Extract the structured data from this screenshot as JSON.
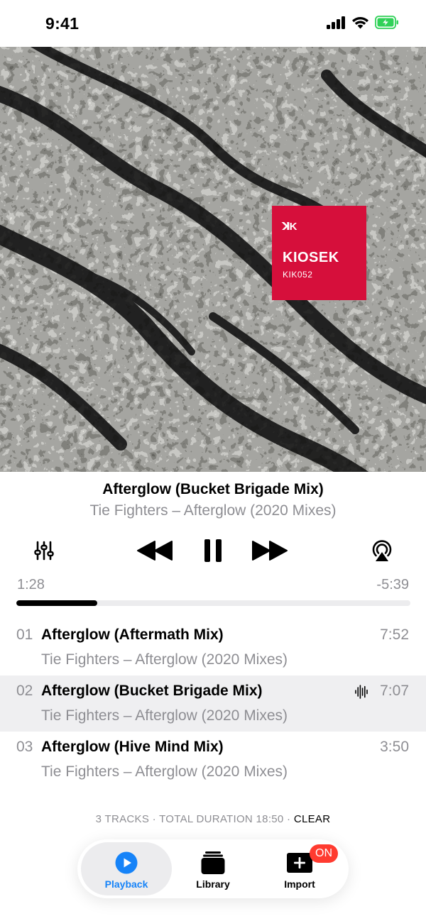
{
  "status_bar": {
    "time": "9:41"
  },
  "artwork": {
    "label_mark": "ꓘK",
    "label_name": "KIOSEK",
    "catalog": "KIK052"
  },
  "now_playing": {
    "title": "Afterglow (Bucket Brigade Mix)",
    "subtitle": "Tie Fighters – Afterglow (2020 Mixes)",
    "elapsed": "1:28",
    "remaining": "-5:39",
    "progress_fraction": 0.206
  },
  "queue": {
    "tracks": [
      {
        "number": "01",
        "title": "Afterglow (Aftermath Mix)",
        "subtitle": "Tie Fighters – Afterglow (2020 Mixes)",
        "duration": "7:52"
      },
      {
        "number": "02",
        "title": "Afterglow (Bucket Brigade Mix)",
        "subtitle": "Tie Fighters – Afterglow (2020 Mixes)",
        "duration": "7:07",
        "playing": true
      },
      {
        "number": "03",
        "title": "Afterglow (Hive Mind Mix)",
        "subtitle": "Tie Fighters – Afterglow (2020 Mixes)",
        "duration": "3:50"
      }
    ],
    "summary": "3 TRACKS · TOTAL DURATION 18:50 · ",
    "clear_label": "CLEAR"
  },
  "tab_bar": {
    "playback_label": "Playback",
    "library_label": "Library",
    "import_label": "Import",
    "import_badge": "ON",
    "active": "Playback"
  },
  "colors": {
    "accent": "#1683f8",
    "badge": "#ff3b30",
    "label_card": "#d60f3b",
    "battery": "#30d158",
    "secondary_text": "#8e8e93"
  },
  "icons": {
    "status": [
      "signal-icon",
      "wifi-icon",
      "battery-charging-icon"
    ],
    "controls": [
      "equalizer-icon",
      "rewind-icon",
      "pause-icon",
      "fast-forward-icon",
      "airplay-icon"
    ],
    "tabs": [
      "play-circle-icon",
      "library-stack-icon",
      "import-plus-icon"
    ]
  }
}
